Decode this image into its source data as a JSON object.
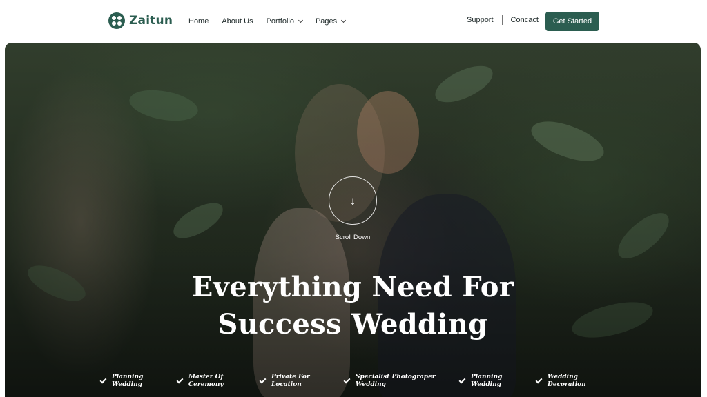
{
  "brand": {
    "name": "Zaitun",
    "accent": "#2b5d50"
  },
  "nav": {
    "items": [
      {
        "label": "Home",
        "has_dropdown": false
      },
      {
        "label": "About Us",
        "has_dropdown": false
      },
      {
        "label": "Portfolio",
        "has_dropdown": true
      },
      {
        "label": "Pages",
        "has_dropdown": true
      }
    ],
    "support": "Support",
    "contact": "Concact",
    "cta": "Get Started"
  },
  "hero": {
    "scroll_label": "Scroll Down",
    "headline_line1": "Everything Need For",
    "headline_line2": "Success Wedding",
    "features": [
      {
        "line1": "Planning",
        "line2": "Wedding"
      },
      {
        "line1": "Master Of",
        "line2": "Ceremony"
      },
      {
        "line1": "Private For",
        "line2": "Location"
      },
      {
        "line1": "Specialist Photograper",
        "line2": "Wedding"
      },
      {
        "line1": "Planning",
        "line2": "Wedding"
      },
      {
        "line1": "Wedding",
        "line2": "Decoration"
      }
    ]
  }
}
